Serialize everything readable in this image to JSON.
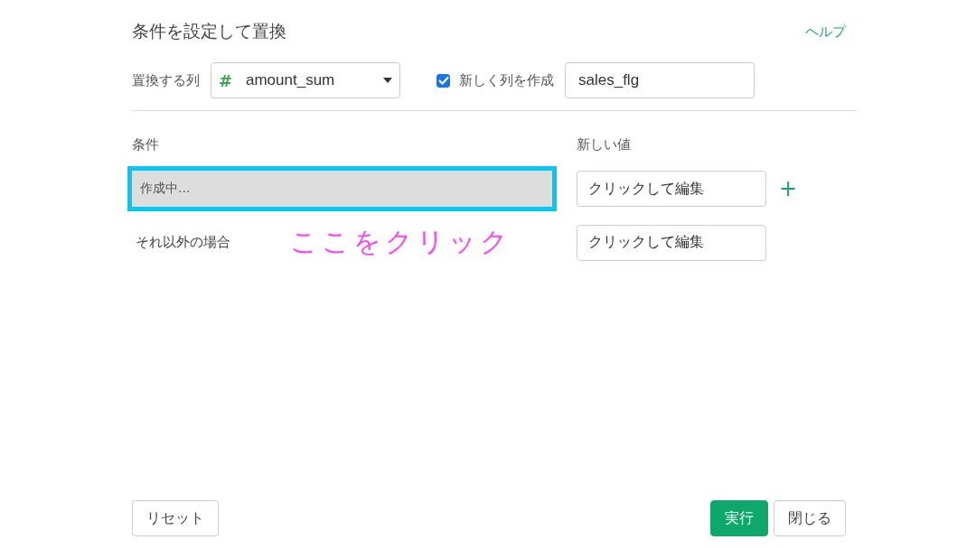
{
  "title": "条件を設定して置換",
  "help_link": "ヘルプ",
  "column_select": {
    "label": "置換する列",
    "type_icon": "#",
    "value": "amount_sum"
  },
  "new_column": {
    "label": "新しく列を作成",
    "checked": true,
    "value": "sales_flg"
  },
  "headers": {
    "condition": "条件",
    "new_value": "新しい値"
  },
  "rules": [
    {
      "kind": "condition",
      "text": "作成中...",
      "highlighted": true,
      "value_placeholder": "クリックして編集",
      "add": "+"
    },
    {
      "kind": "else",
      "text": "それ以外の場合",
      "annotation": "ここをクリック",
      "value_placeholder": "クリックして編集"
    }
  ],
  "buttons": {
    "reset": "リセット",
    "run": "実行",
    "close": "閉じる"
  }
}
